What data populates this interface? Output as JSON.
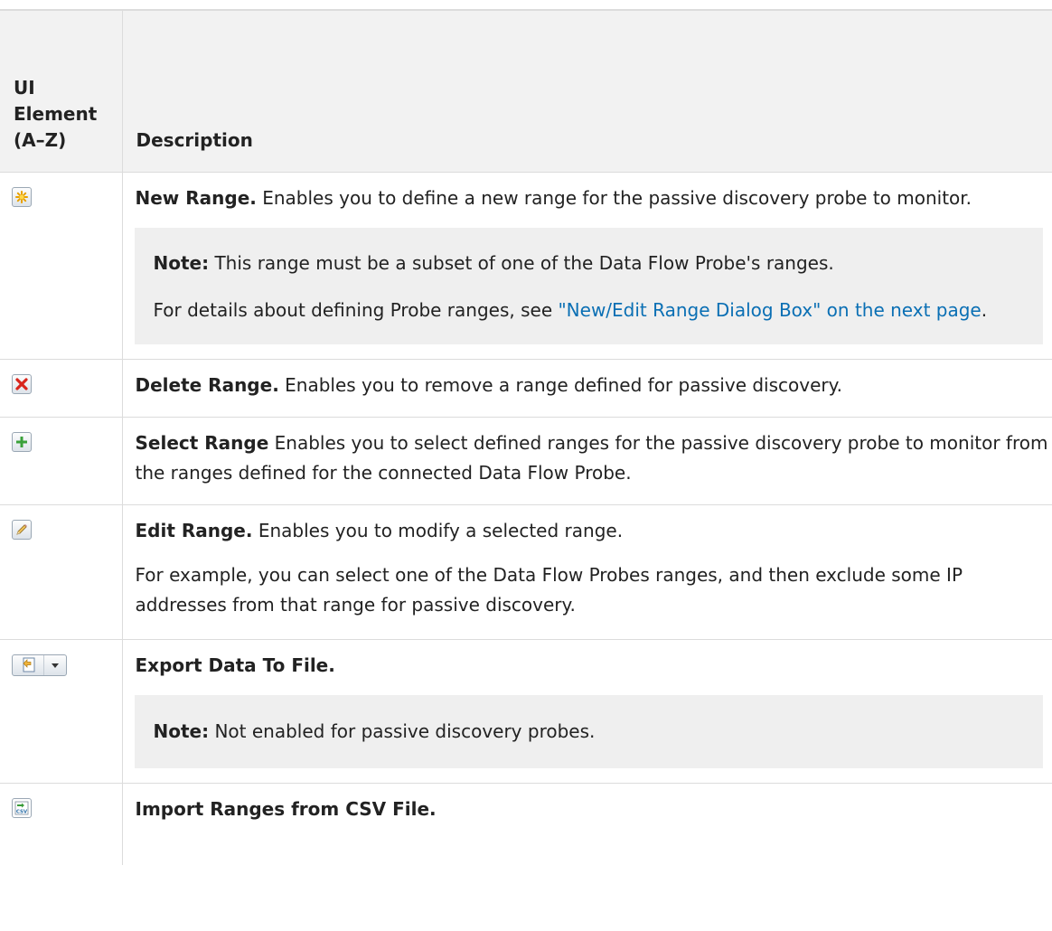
{
  "header": {
    "ui_element_label": "UI Element (A–Z)",
    "description_label": "Description"
  },
  "rows": [
    {
      "icon": "new-range-icon",
      "title": "New Range.",
      "text": " Enables you to define a new range for the passive discovery probe to monitor.",
      "note_label": "Note:",
      "note_text": " This range must be a subset of one of the Data Flow Probe's ranges.",
      "note_detail_prefix": "For details about defining Probe ranges, see ",
      "note_link": "\"New/Edit Range Dialog Box\" on the next page",
      "note_detail_suffix": "."
    },
    {
      "icon": "delete-icon",
      "title": "Delete Range.",
      "text": " Enables you to remove a range defined for passive discovery."
    },
    {
      "icon": "plus-icon",
      "title": "Select Range",
      "text": " Enables you to select defined ranges for the passive discovery probe to monitor from the ranges defined for the connected Data Flow Probe."
    },
    {
      "icon": "edit-pencil-icon",
      "title": "Edit Range.",
      "text": " Enables you to modify a selected range.",
      "extra": "For example, you can select one of the Data Flow Probes ranges, and then exclude some IP addresses from that range for passive discovery."
    },
    {
      "icon": "export-icon",
      "title": "Export Data To File.",
      "note_label": "Note:",
      "note_text": " Not enabled for passive discovery probes."
    },
    {
      "icon": "csv-import-icon",
      "title": "Import Ranges from CSV File."
    }
  ],
  "colors": {
    "link": "#0a6fb4",
    "header_bg": "#f2f2f2",
    "note_bg": "#efefef",
    "border": "#dcdcdc"
  }
}
